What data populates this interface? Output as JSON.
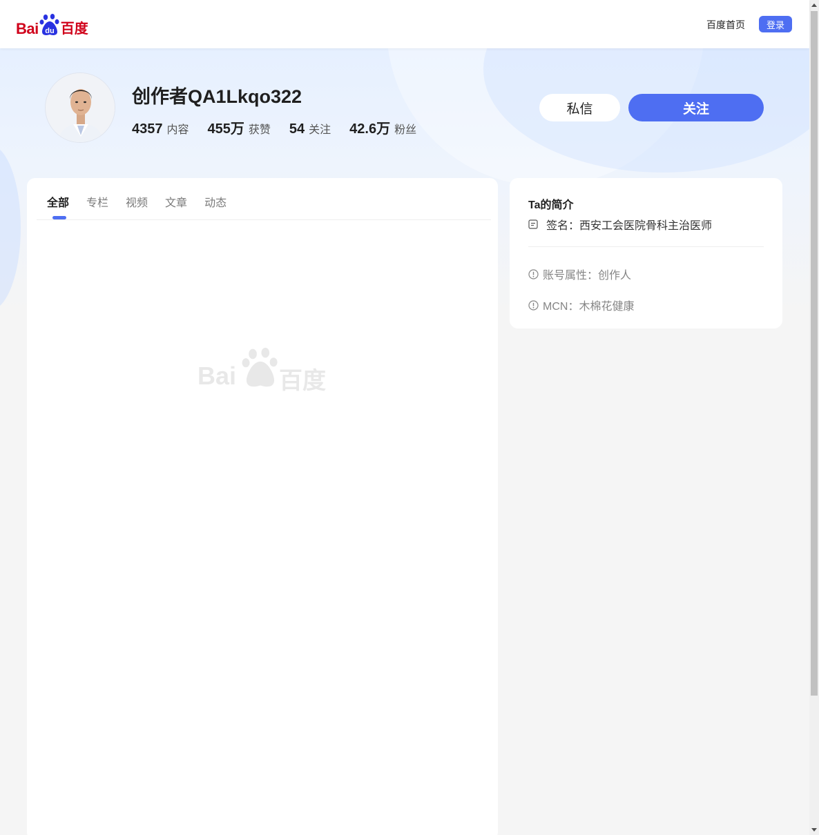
{
  "header": {
    "logo_bai": "Bai",
    "logo_du": "du",
    "logo_cn": "百度",
    "home_link": "百度首页",
    "login_label": "登录"
  },
  "profile": {
    "name": "创作者QA1Lkqo322",
    "stats": [
      {
        "num": "4357",
        "label": "内容"
      },
      {
        "num": "455万",
        "label": "获赞"
      },
      {
        "num": "54",
        "label": "关注"
      },
      {
        "num": "42.6万",
        "label": "粉丝"
      }
    ],
    "message_label": "私信",
    "follow_label": "关注"
  },
  "tabs": [
    {
      "label": "全部",
      "active": true
    },
    {
      "label": "专栏"
    },
    {
      "label": "视频"
    },
    {
      "label": "文章"
    },
    {
      "label": "动态"
    }
  ],
  "placeholder": {
    "bai": "Bai",
    "du": "百度"
  },
  "intro": {
    "title": "Ta的简介",
    "signature": "签名：西安工会医院骨科主治医师",
    "account_type": "账号属性：创作人",
    "mcn": "MCN：木棉花健康"
  },
  "colors": {
    "accent": "#4e6ef2",
    "brand_red": "#d0021b"
  }
}
